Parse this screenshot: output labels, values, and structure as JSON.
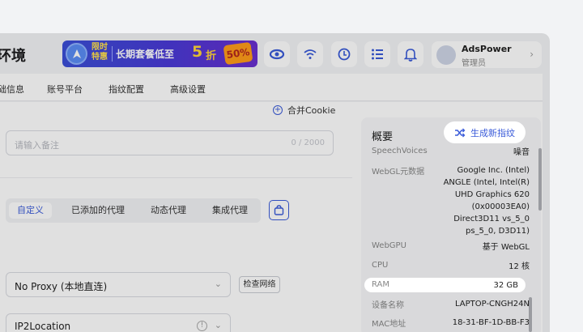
{
  "header": {
    "page_title": "环境",
    "promo": {
      "tag_line1": "限时",
      "tag_line2": "特惠",
      "text": "长期套餐低至",
      "number": "5",
      "unit": "折",
      "badge": "50%"
    },
    "user": {
      "name": "AdsPower",
      "role": "管理员"
    }
  },
  "nav": {
    "tabs": [
      "础信息",
      "账号平台",
      "指纹配置",
      "高级设置"
    ]
  },
  "form": {
    "merge_cookie": "合并Cookie",
    "note_placeholder": "请输入备注",
    "note_counter": "0 / 2000",
    "proxy_tabs": [
      "自定义",
      "已添加的代理",
      "动态代理",
      "集成代理"
    ],
    "proxy_select": "No Proxy (本地直连)",
    "check_network": "检查网络",
    "ip_select": "IP2Location"
  },
  "panel": {
    "title": "概要",
    "generate_button": "生成新指纹",
    "rows": [
      {
        "key": "SpeechVoices",
        "value": "噪音"
      },
      {
        "key": "WebGL元数据",
        "value": "Google Inc. (Intel) ANGLE (Intel, Intel(R) UHD Graphics 620 (0x00003EA0) Direct3D11 vs_5_0 ps_5_0, D3D11)"
      },
      {
        "key": "WebGPU",
        "value": "基于 WebGL"
      },
      {
        "key": "CPU",
        "value": "12 核"
      },
      {
        "key": "RAM",
        "value": "32 GB"
      },
      {
        "key": "设备名称",
        "value": "LAPTOP-CNGH24N"
      },
      {
        "key": "MAC地址",
        "value": "18-31-BF-1D-BB-F3"
      }
    ]
  },
  "colors": {
    "accent": "#3a5bd9",
    "promo_yellow": "#ffd43b"
  }
}
